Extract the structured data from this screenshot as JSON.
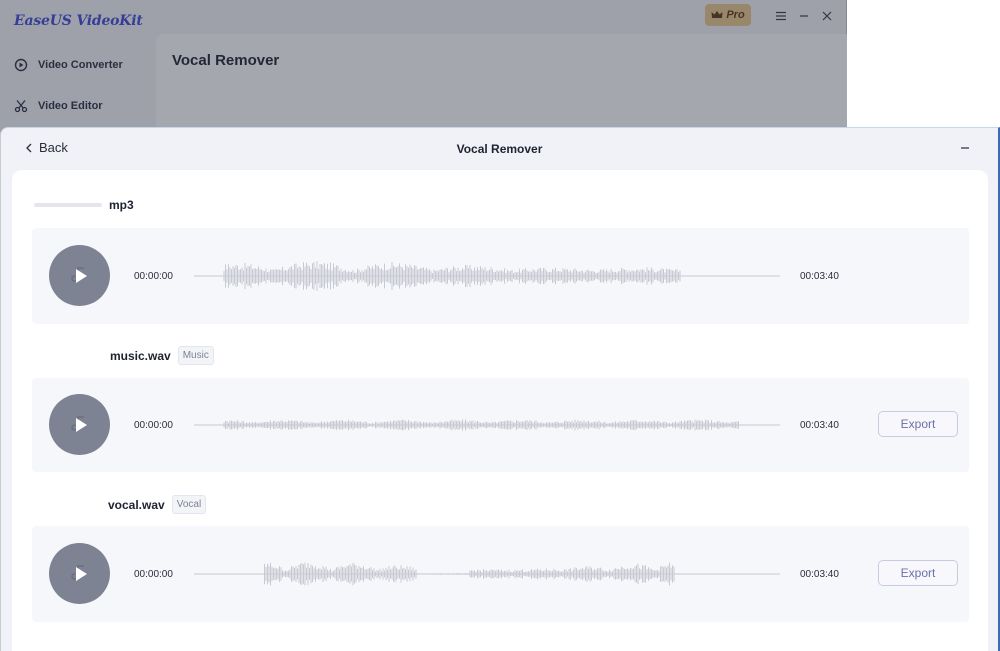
{
  "app": {
    "brand": "EaseUS VideoKit",
    "pro_label": "Pro",
    "sidebar": {
      "items": [
        {
          "label": "Video Converter",
          "icon": "converter-icon"
        },
        {
          "label": "Video Editor",
          "icon": "scissors-icon"
        }
      ]
    },
    "main_title": "Vocal Remover"
  },
  "panel": {
    "back_label": "Back",
    "title": "Vocal Remover",
    "tracks": [
      {
        "filename": "mp3",
        "tag": "",
        "start_time": "00:00:00",
        "end_time": "00:03:40",
        "export_label": ""
      },
      {
        "filename": "music.wav",
        "tag": "Music",
        "start_time": "00:00:00",
        "end_time": "00:03:40",
        "export_label": "Export"
      },
      {
        "filename": "vocal.wav",
        "tag": "Vocal",
        "start_time": "00:00:00",
        "end_time": "00:03:40",
        "export_label": "Export"
      }
    ]
  },
  "colors": {
    "brand": "#3f4ad6",
    "waveform": "#c8cad3",
    "play_button": "#7d8393",
    "export_text": "#6a6fa8"
  }
}
